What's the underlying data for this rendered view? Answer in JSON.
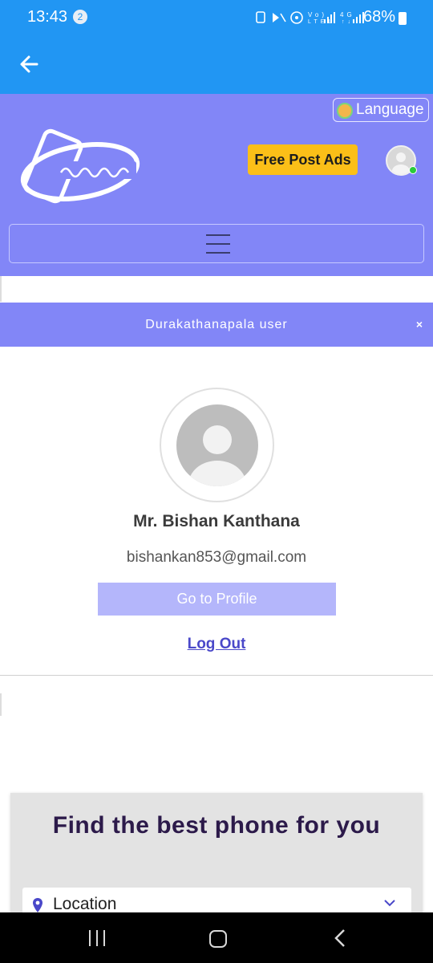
{
  "status_bar": {
    "time": "13:43",
    "notification_count": "2",
    "battery": "68%"
  },
  "header": {
    "language_label": "Language",
    "free_post_label": "Free Post Ads"
  },
  "banner": {
    "title": "Durakathanapala user",
    "close_label": "×"
  },
  "profile": {
    "name": "Mr. Bishan Kanthana",
    "email": "bishankan853@gmail.com",
    "go_profile_label": "Go to Profile",
    "logout_label": "Log Out"
  },
  "search": {
    "title": "Find the best phone for you",
    "location_label": "Location"
  },
  "colors": {
    "appbar": "#2196f3",
    "header": "#8286f7",
    "accent_button": "#fbbf18",
    "profile_button": "#b4b6fb",
    "link": "#4a48c9"
  }
}
